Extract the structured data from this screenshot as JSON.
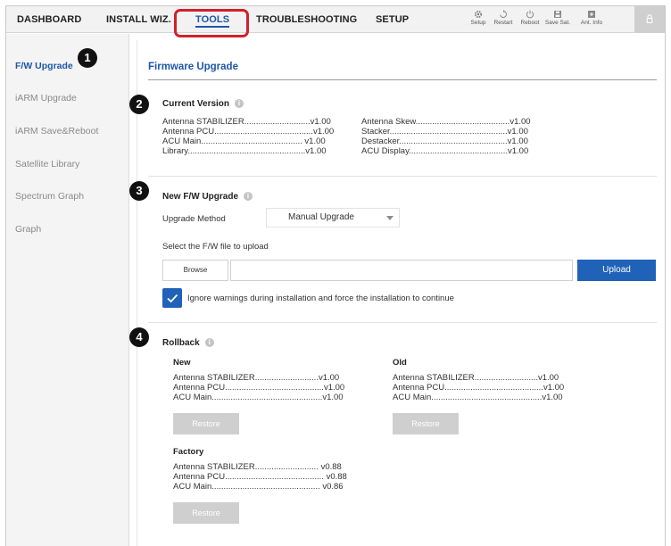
{
  "nav": {
    "tabs": [
      "DASHBOARD",
      "INSTALL WIZ.",
      "TOOLS",
      "TROUBLESHOOTING",
      "SETUP"
    ],
    "active_tab": "TOOLS",
    "tools": [
      {
        "label": "Setup",
        "icon": "gear-icon"
      },
      {
        "label": "Restart",
        "icon": "restart-icon"
      },
      {
        "label": "Reboot",
        "icon": "power-icon"
      },
      {
        "label": "Save Sat.",
        "icon": "save-icon"
      },
      {
        "label": "Ant. Info",
        "icon": "info-icon"
      }
    ],
    "lock_icon": "lock-icon"
  },
  "sidebar": {
    "items": [
      "F/W Upgrade",
      "iARM Upgrade",
      "iARM Save&Reboot",
      "Satellite Library",
      "Spectrum Graph",
      "Graph"
    ],
    "active": "F/W Upgrade"
  },
  "badges": [
    "1",
    "2",
    "3",
    "4"
  ],
  "main": {
    "title": "Firmware Upgrade",
    "current_version": {
      "title": "Current Version",
      "left": [
        "Antenna STABILIZER............................v1.00",
        "Antenna PCU..........................................v1.00",
        "ACU Main........................................... v1.00",
        "Library..................................................v1.00"
      ],
      "right": [
        "Antenna Skew........................................v1.00",
        "Stacker..................................................v1.00",
        "Destacker..............................................v1.00",
        "ACU Display..........................................v1.00"
      ]
    },
    "new_upgrade": {
      "title": "New F/W Upgrade",
      "method_label": "Upgrade Method",
      "method_value": "Manual Upgrade",
      "file_label": "Select the F/W file to upload",
      "browse": "Browse",
      "file_value": "",
      "upload": "Upload",
      "ignore_label": "Ignore warnings during installation and force the installation to continue",
      "ignore_checked": true
    },
    "rollback": {
      "title": "Rollback",
      "new": {
        "title": "New",
        "rows": [
          "Antenna STABILIZER...........................v1.00",
          "Antenna PCU..........................................v1.00",
          "ACU Main...............................................v1.00"
        ],
        "restore": "Restore"
      },
      "old": {
        "title": "Old",
        "rows": [
          "Antenna STABILIZER...........................v1.00",
          "Antenna PCU..........................................v1.00",
          "ACU Main...............................................v1.00"
        ],
        "restore": "Restore"
      },
      "factory": {
        "title": "Factory",
        "rows": [
          "Antenna STABILIZER........................... v0.88",
          "Antenna PCU.......................................... v0.88",
          "ACU Main.............................................. v0.86"
        ],
        "restore": "Restore"
      }
    }
  },
  "colors": {
    "accent": "#1f57a8",
    "button": "#1f62b8",
    "highlight": "#d21f2b",
    "disabled": "#cfcfcf"
  }
}
